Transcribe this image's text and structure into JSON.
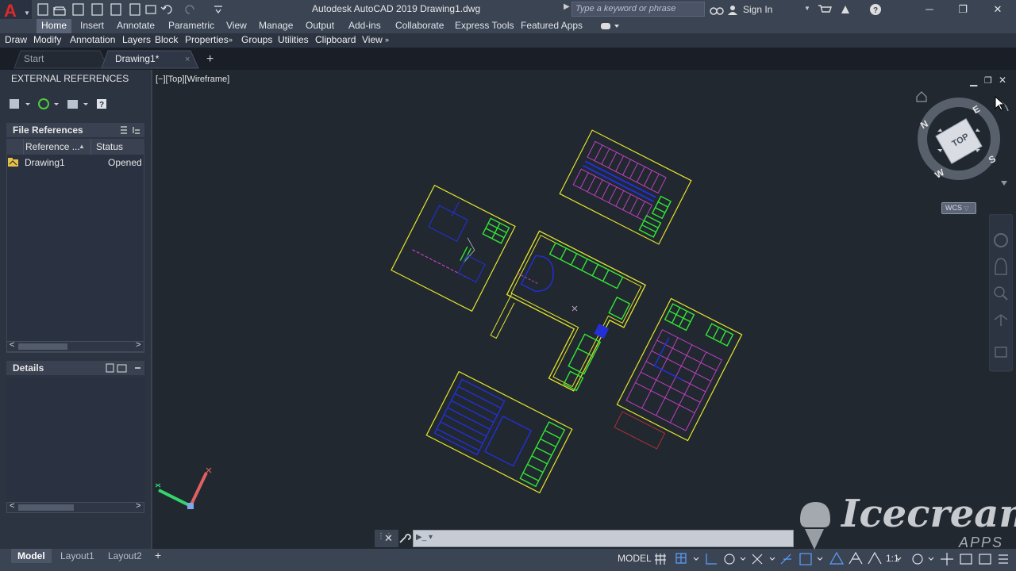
{
  "app": {
    "title": "Autodesk AutoCAD 2019    Drawing1.dwg",
    "search_placeholder": "Type a keyword or phrase",
    "sign_in": "Sign In",
    "logo": "A"
  },
  "ribbon_tabs": [
    {
      "label": "Home",
      "active": true
    },
    {
      "label": "Insert"
    },
    {
      "label": "Annotate"
    },
    {
      "label": "Parametric"
    },
    {
      "label": "View"
    },
    {
      "label": "Manage"
    },
    {
      "label": "Output"
    },
    {
      "label": "Add-ins"
    },
    {
      "label": "Collaborate"
    },
    {
      "label": "Express Tools"
    },
    {
      "label": "Featured Apps"
    }
  ],
  "menu_items": [
    "Draw",
    "Modify",
    "Annotation",
    "Layers",
    "Block",
    "Properties",
    "Groups",
    "Utilities",
    "Clipboard",
    "View"
  ],
  "doc_tabs": [
    "Start",
    "Drawing1*"
  ],
  "palette": {
    "title": "EXTERNAL REFERENCES",
    "file_refs": "File References",
    "col_reference": "Reference ...",
    "col_status": "Status",
    "row_name": "Drawing1",
    "row_status": "Opened",
    "details": "Details"
  },
  "viewport": {
    "label": "[−][Top][Wireframe]",
    "viewcube_top": "TOP",
    "compass": [
      "N",
      "E",
      "S",
      "W"
    ],
    "ucs": "WCS"
  },
  "statusbar": {
    "layouts": [
      "Model",
      "Layout1",
      "Layout2"
    ],
    "model": "MODEL",
    "scale": "1:1"
  },
  "watermark": {
    "brand": "Icecream",
    "sub": "APPS"
  },
  "colors": {
    "yellow": "#e6e62a",
    "green": "#33e633",
    "blue": "#2230d6",
    "magenta": "#c040c0"
  }
}
